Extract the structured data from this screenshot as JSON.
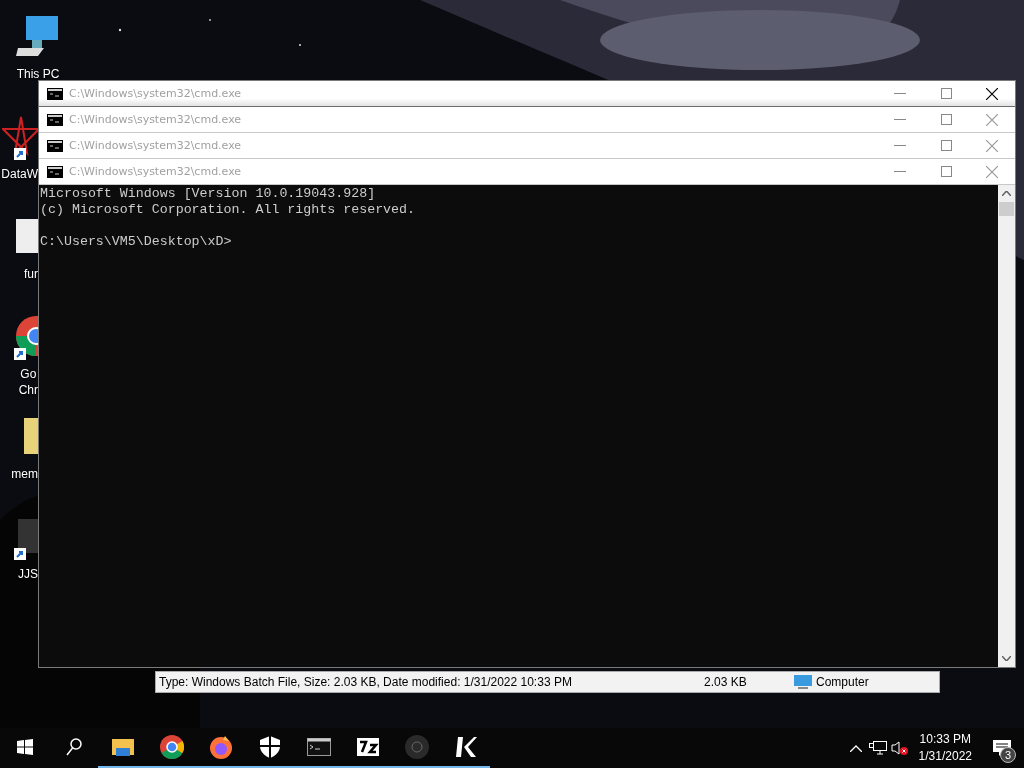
{
  "desktop_icons": [
    {
      "kind": "computer",
      "label_lines": [
        "This PC"
      ],
      "shortcut": false
    },
    {
      "kind": "star-app",
      "label_lines": [
        "DataW"
      ],
      "shortcut": true
    },
    {
      "kind": "document",
      "label_lines": [
        "fur"
      ],
      "shortcut": false
    },
    {
      "kind": "chrome",
      "label_lines": [
        "Go",
        "Chr"
      ],
      "shortcut": true
    },
    {
      "kind": "folder",
      "label_lines": [
        "mem"
      ],
      "shortcut": false
    },
    {
      "kind": "dark-app",
      "label_lines": [
        "JJS"
      ],
      "shortcut": true
    }
  ],
  "windows": [
    {
      "title": "C:\\Windows\\system32\\cmd.exe",
      "active": true
    },
    {
      "title": "C:\\Windows\\system32\\cmd.exe",
      "active": false
    },
    {
      "title": "C:\\Windows\\system32\\cmd.exe",
      "active": false
    },
    {
      "title": "C:\\Windows\\system32\\cmd.exe",
      "active": false
    }
  ],
  "console": {
    "blocks": [
      [
        "Microsoft Windows [Version 10.0.19043.928]",
        "(c) Microsoft Corporation. All rights reserved."
      ],
      [
        "C:\\Users\\VM5\\Desktop\\xD>"
      ]
    ]
  },
  "details_bar": {
    "description": "Type: Windows Batch File, Size: 2.03 KB, Date modified: 1/31/2022 10:33 PM",
    "size": "2.03 KB",
    "zone": "Computer"
  },
  "taskbar": {
    "apps": [
      {
        "kind": "start",
        "running": false
      },
      {
        "kind": "search",
        "running": false
      },
      {
        "kind": "explorer",
        "running": true
      },
      {
        "kind": "chrome",
        "running": true
      },
      {
        "kind": "firefox",
        "running": true
      },
      {
        "kind": "shield",
        "running": true
      },
      {
        "kind": "terminal",
        "running": true
      },
      {
        "kind": "sevenzip",
        "running": true
      },
      {
        "kind": "disc",
        "running": true
      },
      {
        "kind": "k-app",
        "running": true
      }
    ],
    "tray": {
      "time": "10:33 PM",
      "date": "1/31/2022",
      "notifications": "3",
      "muted": true
    }
  }
}
